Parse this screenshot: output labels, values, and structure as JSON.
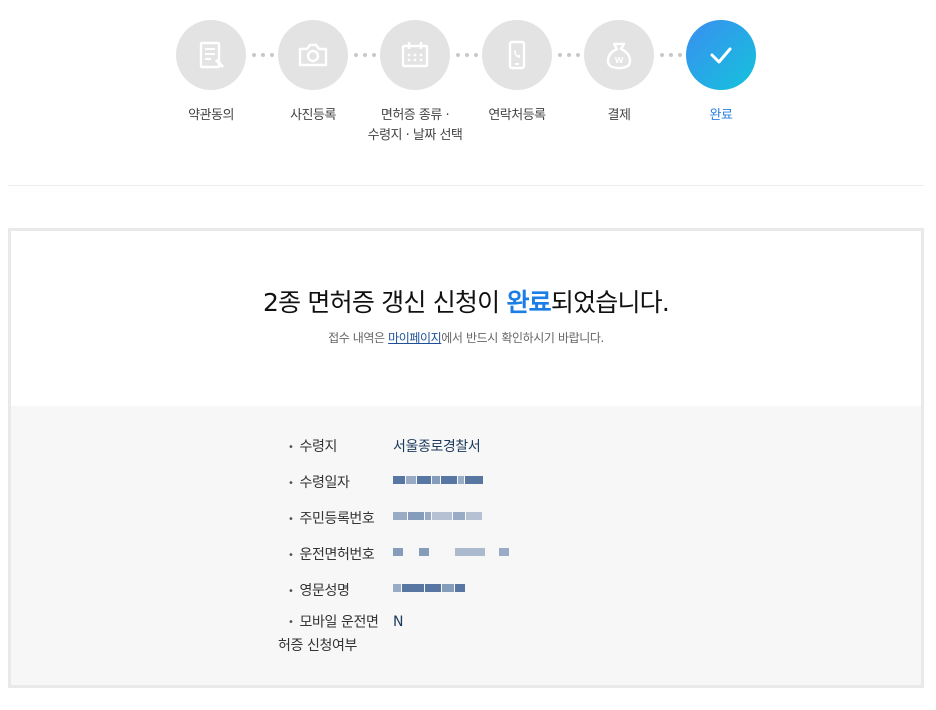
{
  "stepper": {
    "steps": [
      {
        "label": "약관동의",
        "icon": "document-icon"
      },
      {
        "label": "사진등록",
        "icon": "camera-icon"
      },
      {
        "label": "면허증 종류 ·\n수령지 · 날짜 선택",
        "icon": "calendar-icon"
      },
      {
        "label": "연락처등록",
        "icon": "phone-icon"
      },
      {
        "label": "결제",
        "icon": "money-bag-icon"
      },
      {
        "label": "완료",
        "icon": "check-icon"
      }
    ],
    "active_index": 5,
    "colors": {
      "inactive": "#e3e3e3",
      "active_start": "#3a8ef0",
      "active_end": "#14c3dc",
      "active_label": "#2b7fe0"
    }
  },
  "result": {
    "headline_prefix": "2종 면허증 갱신 신청이 ",
    "headline_highlight": "완료",
    "headline_suffix": "되었습니다.",
    "sub_prefix": "접수 내역은 ",
    "sub_link": "마이페이지",
    "sub_suffix": "에서 반드시 확인하시기 바랍니다."
  },
  "details": {
    "pickup_place_label": "수령지",
    "pickup_place_value": "서울종로경찰서",
    "pickup_date_label": "수령일자",
    "resident_number_label": "주민등록번호",
    "license_number_label": "운전면허번호",
    "english_name_label": "영문성명",
    "mobile_license_label_line1": "모바일 운전면",
    "mobile_license_label_line2": "허증 신청여부",
    "mobile_license_value": "N"
  }
}
